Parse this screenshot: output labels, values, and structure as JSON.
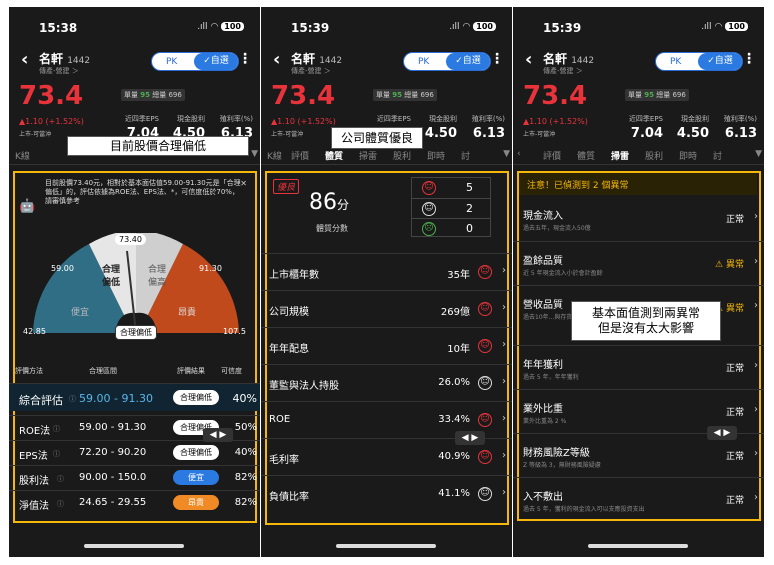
{
  "phone1": {
    "time": "15:38",
    "overlay_title": "目前股價合理偏低",
    "tip": {
      "text": "目前股價73.40元，相對於基本面估值59.00-91.30元是「合理偏低」的，評估依據為ROE法、EPS法、*，可信度低於70%，請審慎參考"
    },
    "gauge": {
      "price_tag": "73.40",
      "left_low": "59.00",
      "right_high": "91.30",
      "min": "42.85",
      "max": "107.5",
      "labels": {
        "cheap": "便宜",
        "fair_low": "合理\n偏低",
        "fair_high": "合理\n偏高",
        "expensive": "昂貴",
        "current": "合理偏低"
      }
    },
    "table": {
      "headers": [
        "評價方法",
        "合理區間",
        "評價結果",
        "可信度"
      ],
      "rows": [
        {
          "method": "綜合評估",
          "range": "59.00 - 91.30",
          "result": "合理偏低",
          "conf": "40%"
        },
        {
          "method": "ROE法",
          "range": "59.00 - 91.30",
          "result": "合理偏低",
          "conf": "50%"
        },
        {
          "method": "EPS法",
          "range": "72.20 - 90.20",
          "result": "合理偏低",
          "conf": "40%"
        },
        {
          "method": "股利法",
          "range": "90.00 - 150.0",
          "result": "便宜",
          "conf": "82%"
        },
        {
          "method": "淨值法",
          "range": "24.65 - 29.55",
          "result": "昂貴",
          "conf": "82%"
        }
      ]
    }
  },
  "phone2": {
    "time": "15:39",
    "overlay_title": "公司體質優良",
    "score": {
      "quality": "優良",
      "value": "86",
      "unit": "分",
      "label": "體質分數",
      "good": "5",
      "neutral": "2",
      "bad": "0"
    },
    "metrics": [
      {
        "label": "上市櫃年數",
        "value": "35年",
        "face": "good"
      },
      {
        "label": "公司規模",
        "value": "269億",
        "face": "good"
      },
      {
        "label": "年年配息",
        "value": "10年",
        "face": "good"
      },
      {
        "label": "董監與法人持股",
        "value": "26.0%",
        "face": "neutral"
      },
      {
        "label": "ROE",
        "value": "33.4%",
        "face": "good"
      },
      {
        "label": "毛利率",
        "value": "40.9%",
        "face": "good"
      },
      {
        "label": "負債比率",
        "value": "41.1%",
        "face": "neutral"
      }
    ]
  },
  "phone3": {
    "time": "15:39",
    "overlay_title": "基本面值測到兩異常\n但是沒有太大影響",
    "alert": "注意！已偵測到 2 個異常",
    "rows": [
      {
        "title": "現金流入",
        "desc": "過去五年，現金流入50億",
        "status": "正常"
      },
      {
        "title": "盈餘品質",
        "desc": "近 5 年現金流入小於會計盈餘",
        "status": "異常",
        "warn": true
      },
      {
        "title": "營收品質",
        "desc": "過去10年...與存貨佔...",
        "status": "異常",
        "warn": true
      },
      {
        "title": "年年獲利",
        "desc": "過去 5 年，年年獲利",
        "status": "正常"
      },
      {
        "title": "業外比重",
        "desc": "業外比重為 2 %",
        "status": "正常"
      },
      {
        "title": "財務風險Z等級",
        "desc": "Z 等級為 3，無財務風險疑慮",
        "status": "正常"
      },
      {
        "title": "入不敷出",
        "desc": "過去 5 年，獲利的現金流入可以支應投資支出",
        "status": "正常"
      }
    ]
  },
  "common": {
    "stock_name": "名軒",
    "stock_code": "1442",
    "sub": "傳產-營建 ＞",
    "pk": "PK",
    "watch": "✓自選",
    "price": "73.4",
    "change": "▲1.10 (+1.52%)",
    "market": "上市-可當沖",
    "badge1": "單量",
    "badge1_val": "95",
    "badge2": "總量 696",
    "eps_label": "近四季EPS",
    "eps": "7.04",
    "div_label": "現金股利",
    "div": "4.50",
    "yield_label": "殖利率(%)",
    "yield": "6.13",
    "tabs": [
      "K線",
      "評價",
      "體質",
      "掃雷",
      "股利",
      "即時",
      "討"
    ],
    "signal": ".ıll",
    "battery": "100"
  }
}
